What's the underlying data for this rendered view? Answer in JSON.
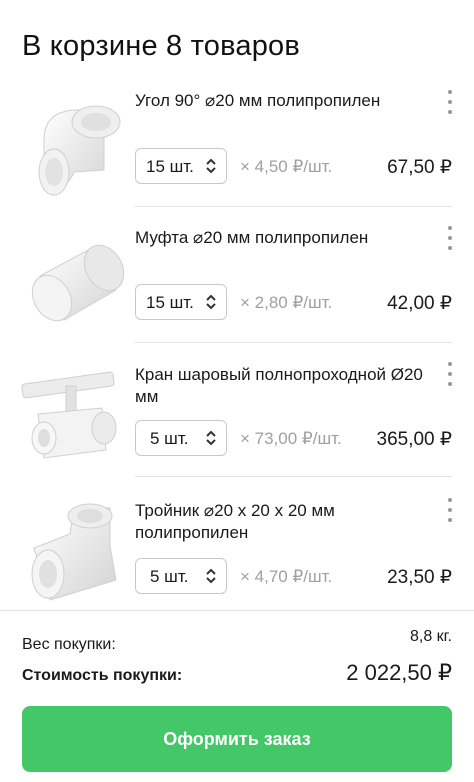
{
  "cart": {
    "title": "В корзине 8 товаров",
    "items": [
      {
        "name": "Угол 90° ⌀20 мм полипропилен",
        "qty": "15 шт.",
        "unit_price": "× 4,50  ₽/шт.",
        "total": "67,50 ₽",
        "thumb_icon": "pipe-elbow-90-icon"
      },
      {
        "name": "Муфта ⌀20 мм полипропилен",
        "qty": "15 шт.",
        "unit_price": "× 2,80  ₽/шт.",
        "total": "42,00 ₽",
        "thumb_icon": "pipe-coupling-icon"
      },
      {
        "name": "Кран шаровый полнопроходной Ø20 мм",
        "qty": "5 шт.",
        "unit_price": "× 73,00  ₽/шт.",
        "total": "365,00 ₽",
        "thumb_icon": "ball-valve-icon"
      },
      {
        "name": "Тройник ⌀20 х 20 х 20 мм полипропилен",
        "qty": "5 шт.",
        "unit_price": "× 4,70  ₽/шт.",
        "total": "23,50 ₽",
        "thumb_icon": "pipe-tee-icon"
      }
    ]
  },
  "summary": {
    "weight_label": "Вес покупки:",
    "weight_value": "8,8 кг.",
    "cost_label": "Стоимость покупки:",
    "cost_value": "2 022,50 ₽"
  },
  "checkout_label": "Оформить заказ",
  "colors": {
    "accent": "#44c767",
    "muted_text": "#a0a0a0",
    "divider": "#e3e3e3"
  }
}
